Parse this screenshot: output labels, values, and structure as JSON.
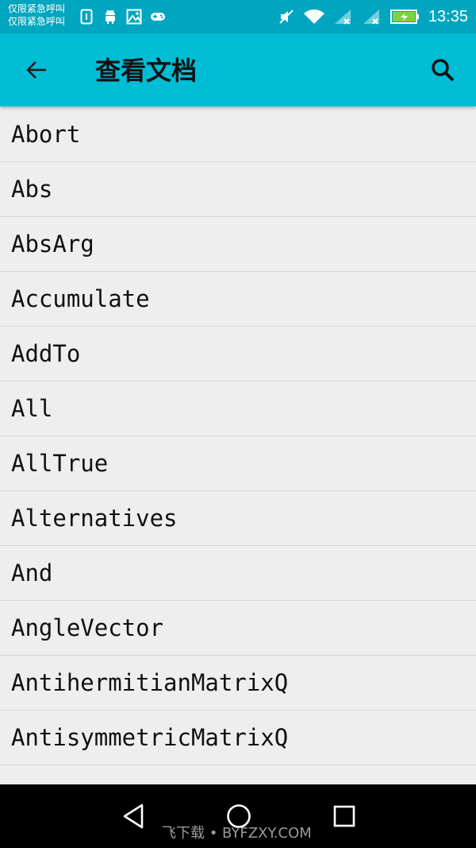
{
  "status_bar": {
    "carrier_line1": "仅限紧急呼叫",
    "carrier_line2": "仅限紧急呼叫",
    "left_icons": [
      "sim-icon",
      "android-icon",
      "image-icon",
      "gamepad-icon"
    ],
    "right_icons": [
      "mute-icon",
      "wifi-icon",
      "signal-icon",
      "signal-icon",
      "battery-charging-icon"
    ],
    "time": "13:35",
    "battery_color": "#7fd23a"
  },
  "toolbar": {
    "title": "查看文档",
    "back_icon": "arrow-left-icon",
    "search_icon": "search-icon",
    "background": "#00bcd4"
  },
  "doc_list": {
    "items": [
      "Abort",
      "Abs",
      "AbsArg",
      "Accumulate",
      "AddTo",
      "All",
      "AllTrue",
      "Alternatives",
      "And",
      "AngleVector",
      "AntihermitianMatrixQ",
      "AntisymmetricMatrixQ",
      ""
    ]
  },
  "nav_bar": {
    "back_icon": "triangle-back-icon",
    "home_icon": "circle-home-icon",
    "recents_icon": "square-recents-icon",
    "watermark": "飞下载 • BYFZXY.COM"
  }
}
